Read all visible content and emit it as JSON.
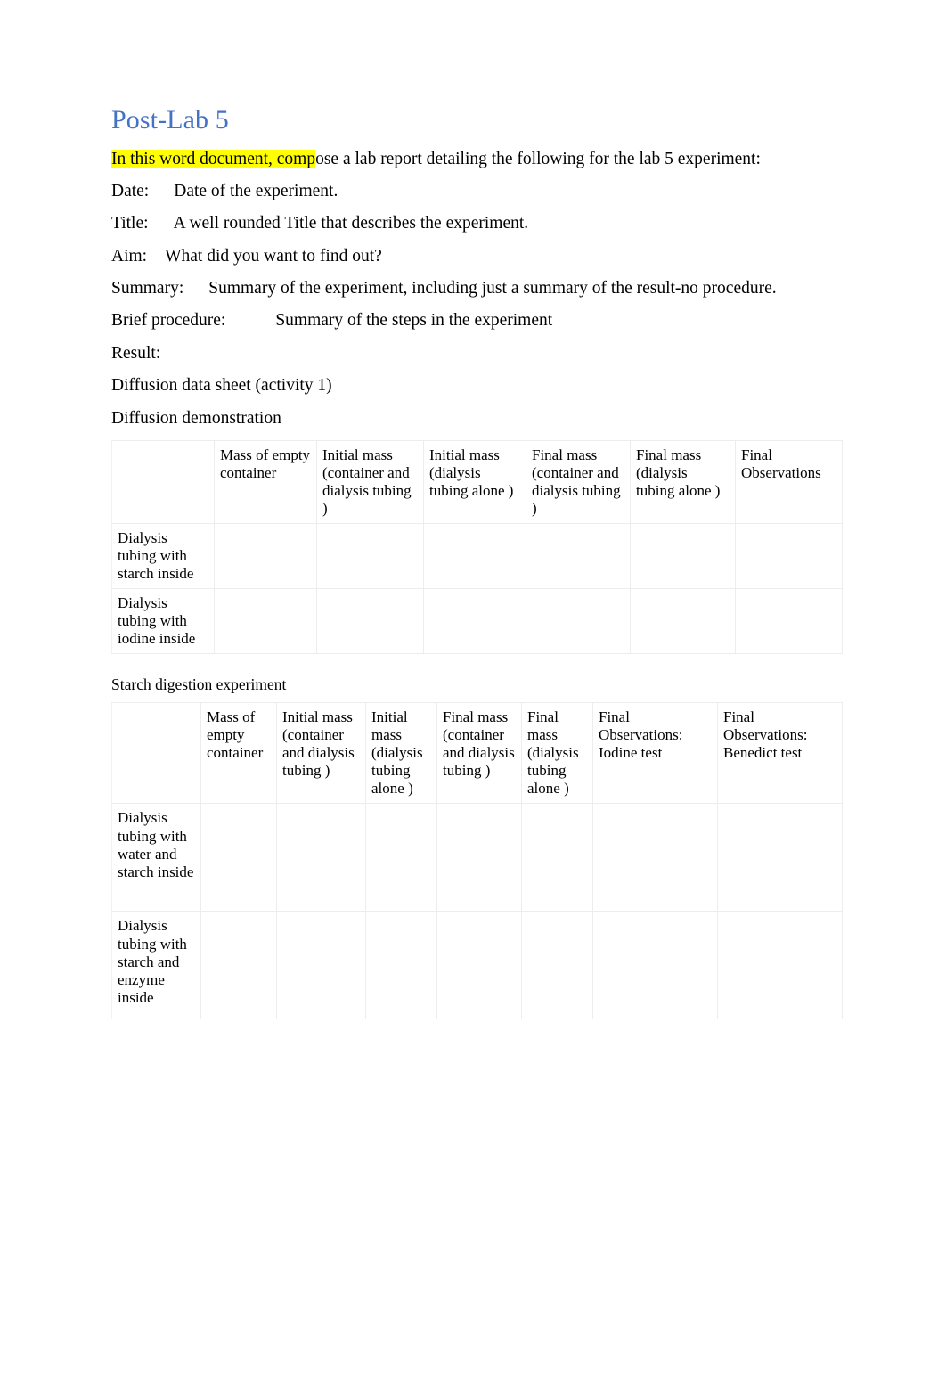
{
  "document": {
    "title": "Post-Lab 5",
    "title_color": "#4472C4",
    "highlight_color": "#FFFF00",
    "intro_highlighted": "In this word document, comp",
    "intro_rest": "ose a lab report detailing the following for the lab 5 experiment:",
    "fields": [
      {
        "label": "Date:",
        "value": "Date of the experiment."
      },
      {
        "label": "Title:",
        "value": "A well rounded Title that describes the experiment."
      },
      {
        "label": "Aim:",
        "value": "What did you want to find out?"
      },
      {
        "label": "Summary:",
        "value": "Summary of the experiment, including just a summary of the result-no procedure."
      },
      {
        "label": "Brief procedure:",
        "value": "Summary of the steps in the experiment"
      },
      {
        "label": "Result:",
        "value": ""
      }
    ],
    "section_heading": "Diffusion data sheet (activity 1)",
    "table1_caption": "Diffusion demonstration",
    "table2_caption": "Starch digestion experiment"
  },
  "table1": {
    "headers": [
      "",
      "Mass of empty container",
      "Initial mass (container and dialysis tubing )",
      "Initial mass (dialysis tubing alone )",
      "Final mass (container and dialysis tubing )",
      "Final mass (dialysis tubing alone )",
      "Final Observations"
    ],
    "rows": [
      {
        "label": "Dialysis tubing with starch inside",
        "cells": [
          "",
          "",
          "",
          "",
          "",
          ""
        ]
      },
      {
        "label": "Dialysis tubing with iodine inside",
        "cells": [
          "",
          "",
          "",
          "",
          "",
          ""
        ]
      }
    ]
  },
  "table2": {
    "headers": [
      "",
      "Mass of empty container",
      "Initial mass (container and dialysis tubing )",
      "Initial mass (dialysis tubing alone )",
      "Final mass (container and dialysis tubing )",
      "Final mass (dialysis tubing alone )",
      "Final Observations: Iodine test",
      "Final Observations: Benedict test"
    ],
    "rows": [
      {
        "label": "Dialysis tubing with water and starch inside",
        "cells": [
          "",
          "",
          "",
          "",
          "",
          "",
          ""
        ]
      },
      {
        "label": "Dialysis tubing with starch and enzyme inside",
        "cells": [
          "",
          "",
          "",
          "",
          "",
          "",
          ""
        ]
      }
    ]
  }
}
